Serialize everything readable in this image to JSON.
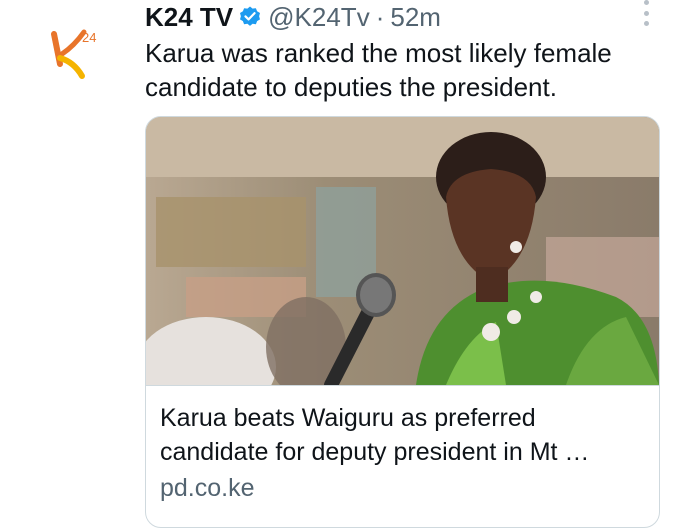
{
  "tweet": {
    "display_name": "K24 TV",
    "verified_icon": "verified-badge-icon",
    "handle": "@K24Tv",
    "separator": "·",
    "time": "52m",
    "text": "Karua was ranked the most likely female candidate to deputies the president.",
    "avatar_icon": "k24-logo-icon",
    "more_icon": "more-vertical-icon"
  },
  "card": {
    "title": "Karua beats Waiguru as preferred candidate for deputy president in Mt …",
    "domain": "pd.co.ke",
    "image_icon": "news-photo"
  },
  "colors": {
    "verified_blue": "#1d9bf0",
    "secondary_text": "#536471",
    "border": "#cfd9de",
    "logo_orange": "#e8742a",
    "logo_yellow": "#f5b400"
  }
}
